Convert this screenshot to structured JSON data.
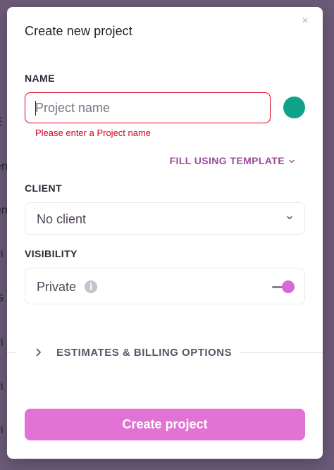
{
  "modal": {
    "title": "Create new project",
    "close_icon": "×"
  },
  "name_section": {
    "label": "NAME",
    "placeholder": "Project name",
    "value": "",
    "error": "Please enter a Project name",
    "color": "#0ea28b"
  },
  "template": {
    "label": "FILL USING TEMPLATE",
    "chevron": "⌄"
  },
  "client_section": {
    "label": "CLIENT",
    "selected": "No client",
    "chevron": "⌄"
  },
  "visibility_section": {
    "label": "VISIBILITY",
    "value": "Private",
    "info_icon": "i",
    "toggle_on": true
  },
  "estimates": {
    "label": "ESTIMATES & BILLING OPTIONS"
  },
  "actions": {
    "create_label": "Create project"
  },
  "background": {
    "fragments": [
      "E",
      "en",
      "en",
      "vi",
      "G",
      "vi",
      "vi",
      "vi"
    ]
  },
  "colors": {
    "accent": "#e073d4",
    "error": "#d6001c",
    "link": "#9b4b9b",
    "project_color": "#0ea28b",
    "toggle_knob": "#d86ad5"
  }
}
